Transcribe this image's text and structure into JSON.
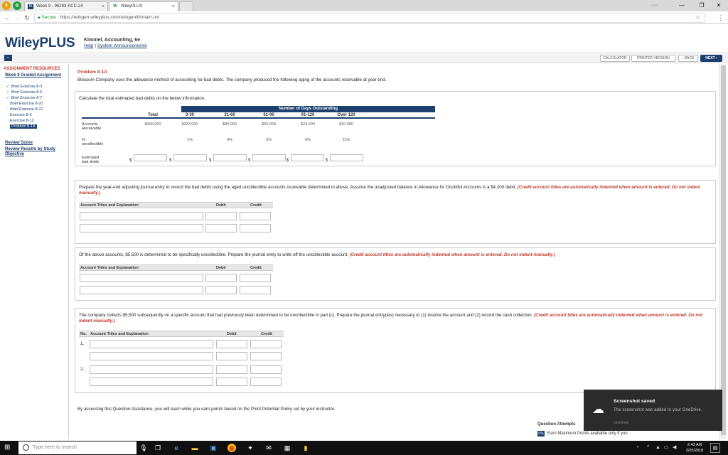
{
  "browser": {
    "tabs": [
      {
        "title": "Week 9 - 96283-ACC-24"
      },
      {
        "title": "WileyPLUS"
      }
    ],
    "secure_label": "Secure",
    "url": "https://edugen.wileyplus.com/edugen/lti/main.uni"
  },
  "header": {
    "logo": "WileyPLUS",
    "course": "Kimmel, Accounting, 6e",
    "help": "Help",
    "announcements": "System Announcements"
  },
  "toolbar": {
    "calculator": "CALCULATOR",
    "printer": "PRINTER VERSION",
    "back": "‹ BACK",
    "next": "NEXT ›"
  },
  "sidebar": {
    "heading": "ASSIGNMENT RESOURCES",
    "assignment_link": "Week 9 Graded Assignment",
    "items": [
      {
        "label": "Brief Exercise 8-3"
      },
      {
        "label": "Brief Exercise 8-5"
      },
      {
        "label": "Brief Exercise 8-7"
      },
      {
        "label": "Brief Exercise 8-10"
      },
      {
        "label": "Brief Exercise 8-12"
      },
      {
        "label": "Exercise 8-3"
      },
      {
        "label": "Exercise 8-12"
      },
      {
        "label": "Problem 8-1A"
      }
    ],
    "review_score": "Review Score",
    "review_results": "Review Results by Study Objective"
  },
  "problem": {
    "title": "Problem 8-1A",
    "description": "Blossom Company uses the allowance method of accounting for bad debts. The company produced the following aging of the accounts receivable at year end."
  },
  "part_a": {
    "instruction": "Calculate the total estimated bad debts on the below information.",
    "group_header": "Number of Days Outstanding",
    "columns": [
      "Total",
      "0-30",
      "31-60",
      "61-90",
      "91-120",
      "Over 120"
    ],
    "rows": [
      {
        "label": "Accounts Receivable",
        "values": [
          "$406,000",
          "$233,000",
          "$89,000",
          "$50,000",
          "$24,000",
          "$10,000"
        ]
      },
      {
        "label": "% uncollectible",
        "values": [
          "",
          "1%",
          "4%",
          "5%",
          "9%",
          "11%"
        ]
      }
    ],
    "estimated_label": "Estimated bad debts",
    "currency": "$"
  },
  "part_b": {
    "instruction": "Prepare the year-end adjusting journal entry to record the bad debts using the aged uncollectible accounts receivable determined in above. Assume the unadjusted balance in Allowance for Doubtful Accounts is a $4,200 debit.",
    "note": "(Credit account titles are automatically indented when amount is entered. Do not indent manually.)",
    "col_account": "Account Titles and Explanation",
    "col_debit": "Debit",
    "col_credit": "Credit"
  },
  "part_c": {
    "instruction": "Of the above accounts, $5,500 is determined to be specifically uncollectible. Prepare the journal entry to write off the uncollectible account.",
    "note": "(Credit account titles are automatically indented when amount is entered. Do not indent manually.)",
    "col_account": "Account Titles and Explanation",
    "col_debit": "Debit",
    "col_credit": "Credit"
  },
  "part_d": {
    "instruction": "The company collects $5,500 subsequently on a specific account that had previously been determined to be uncollectible in part (c). Prepare the journal entry(ies) necessary to (1) restore the account and (2) record the cash collection.",
    "note": "(Credit account titles are automatically indented when amount is entered. Do not indent manually.)",
    "col_no": "No.",
    "col_account": "Account Titles and Explanation",
    "col_debit": "Debit",
    "col_credit": "Credit",
    "entry_numbers": [
      "1.",
      "2."
    ]
  },
  "footer": {
    "assistance": "By accessing this Question Assistance, you will learn while you earn points based on the Point Potential Policy set by your instructor.",
    "question_attempts": "Question Attempts",
    "earn_maximum": "Earn Maximum Points available only if you",
    "earn_badge": "0%"
  },
  "toast": {
    "title": "Screenshot saved",
    "message": "The screenshot was added to your OneDrive.",
    "source": "OneDrive"
  },
  "taskbar": {
    "search_placeholder": "Type here to search",
    "time": "2:43 AM",
    "date": "3/25/2018"
  }
}
